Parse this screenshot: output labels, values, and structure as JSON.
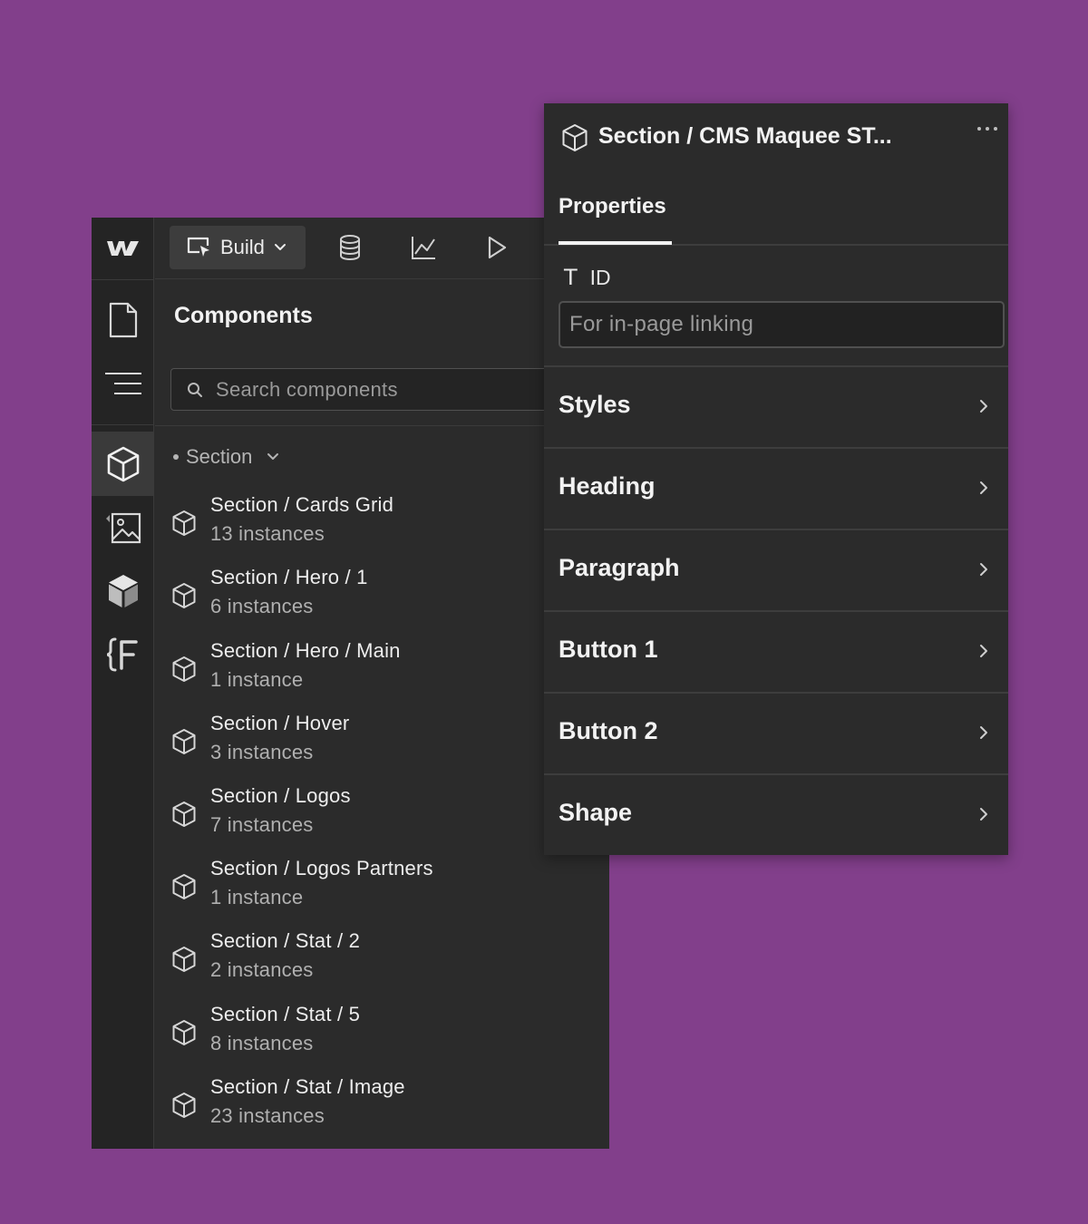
{
  "colors": {
    "background": "#823f8b",
    "panel": "#2b2b2b",
    "rail": "#242424",
    "text": "#e6e6e6",
    "muted": "#9a9a9a"
  },
  "left_panel": {
    "logo_icon": "webflow-logo-icon",
    "toolbar": {
      "build_label": "Build",
      "icons": [
        "cursor-box-icon",
        "chevron-down-icon",
        "database-icon",
        "line-chart-icon",
        "play-icon"
      ]
    },
    "rail_icons": [
      "page-icon",
      "navigator-icon",
      "components-icon",
      "assets-icon",
      "cube-solid-icon",
      "variables-icon"
    ],
    "components": {
      "title": "Components",
      "search_placeholder": "Search components",
      "group_label": "Section",
      "items": [
        {
          "name": "Section / Cards Grid",
          "count": "13 instances"
        },
        {
          "name": "Section / Hero / 1",
          "count": "6 instances"
        },
        {
          "name": "Section / Hero / Main",
          "count": "1 instance"
        },
        {
          "name": "Section / Hover",
          "count": "3 instances"
        },
        {
          "name": "Section / Logos",
          "count": "7 instances"
        },
        {
          "name": "Section / Logos Partners",
          "count": "1 instance"
        },
        {
          "name": "Section / Stat / 2",
          "count": "2 instances"
        },
        {
          "name": "Section / Stat / 5",
          "count": "8 instances"
        },
        {
          "name": "Section / Stat / Image",
          "count": "23 instances"
        }
      ]
    }
  },
  "right_panel": {
    "title": "Section / CMS Maquee ST...",
    "tab_label": "Properties",
    "id_field": {
      "type_glyph": "T",
      "label": "ID",
      "placeholder": "For in-page linking"
    },
    "sections": [
      "Styles",
      "Heading",
      "Paragraph",
      "Button 1",
      "Button 2",
      "Shape"
    ]
  }
}
